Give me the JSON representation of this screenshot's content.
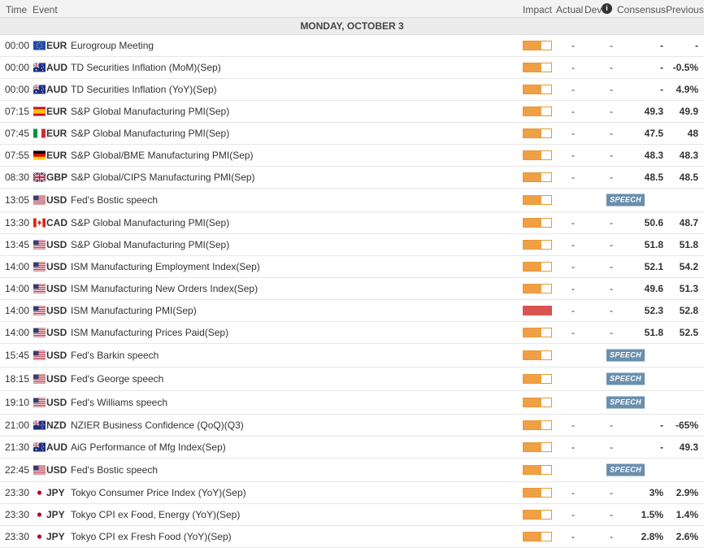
{
  "header": {
    "time": "Time",
    "event": "Event",
    "impact": "Impact",
    "actual": "Actual",
    "dev": "Dev",
    "info_icon": "i",
    "consensus": "Consensus",
    "previous": "Previous"
  },
  "day_label": "MONDAY, OCTOBER 3",
  "colors": {
    "impact_medium": "#f0a044",
    "impact_high": "#d9534f",
    "speech_tag": "#6a8fae"
  },
  "events": [
    {
      "time": "00:00",
      "flag": "eu",
      "currency": "EUR",
      "event": "Eurogroup Meeting",
      "impact": "medium",
      "impact_level": 0.66,
      "actual": "-",
      "dev": "-",
      "consensus": "-",
      "previous": "-"
    },
    {
      "time": "00:00",
      "flag": "au",
      "currency": "AUD",
      "event": "TD Securities Inflation (MoM)(Sep)",
      "impact": "medium",
      "impact_level": 0.66,
      "actual": "-",
      "dev": "-",
      "consensus": "-",
      "previous": "-0.5%"
    },
    {
      "time": "00:00",
      "flag": "au",
      "currency": "AUD",
      "event": "TD Securities Inflation (YoY)(Sep)",
      "impact": "medium",
      "impact_level": 0.66,
      "actual": "-",
      "dev": "-",
      "consensus": "-",
      "previous": "4.9%"
    },
    {
      "time": "07:15",
      "flag": "es",
      "currency": "EUR",
      "event": "S&P Global Manufacturing PMI(Sep)",
      "impact": "medium",
      "impact_level": 0.66,
      "actual": "-",
      "dev": "-",
      "consensus": "49.3",
      "previous": "49.9"
    },
    {
      "time": "07:45",
      "flag": "it",
      "currency": "EUR",
      "event": "S&P Global Manufacturing PMI(Sep)",
      "impact": "medium",
      "impact_level": 0.66,
      "actual": "-",
      "dev": "-",
      "consensus": "47.5",
      "previous": "48"
    },
    {
      "time": "07:55",
      "flag": "de",
      "currency": "EUR",
      "event": "S&P Global/BME Manufacturing PMI(Sep)",
      "impact": "medium",
      "impact_level": 0.66,
      "actual": "-",
      "dev": "-",
      "consensus": "48.3",
      "previous": "48.3"
    },
    {
      "time": "08:30",
      "flag": "gb",
      "currency": "GBP",
      "event": "S&P Global/CIPS Manufacturing PMI(Sep)",
      "impact": "medium",
      "impact_level": 0.66,
      "actual": "-",
      "dev": "-",
      "consensus": "48.5",
      "previous": "48.5"
    },
    {
      "time": "13:05",
      "flag": "us",
      "currency": "USD",
      "event": "Fed's Bostic speech",
      "impact": "medium",
      "impact_level": 0.66,
      "speech": "SPEECH"
    },
    {
      "time": "13:30",
      "flag": "ca",
      "currency": "CAD",
      "event": "S&P Global Manufacturing PMI(Sep)",
      "impact": "medium",
      "impact_level": 0.66,
      "actual": "-",
      "dev": "-",
      "consensus": "50.6",
      "previous": "48.7"
    },
    {
      "time": "13:45",
      "flag": "us",
      "currency": "USD",
      "event": "S&P Global Manufacturing PMI(Sep)",
      "impact": "medium",
      "impact_level": 0.66,
      "actual": "-",
      "dev": "-",
      "consensus": "51.8",
      "previous": "51.8"
    },
    {
      "time": "14:00",
      "flag": "us",
      "currency": "USD",
      "event": "ISM Manufacturing Employment Index(Sep)",
      "impact": "medium",
      "impact_level": 0.66,
      "actual": "-",
      "dev": "-",
      "consensus": "52.1",
      "previous": "54.2"
    },
    {
      "time": "14:00",
      "flag": "us",
      "currency": "USD",
      "event": "ISM Manufacturing New Orders Index(Sep)",
      "impact": "medium",
      "impact_level": 0.66,
      "actual": "-",
      "dev": "-",
      "consensus": "49.6",
      "previous": "51.3"
    },
    {
      "time": "14:00",
      "flag": "us",
      "currency": "USD",
      "event": "ISM Manufacturing PMI(Sep)",
      "impact": "high",
      "impact_level": 1.0,
      "actual": "-",
      "dev": "-",
      "consensus": "52.3",
      "previous": "52.8"
    },
    {
      "time": "14:00",
      "flag": "us",
      "currency": "USD",
      "event": "ISM Manufacturing Prices Paid(Sep)",
      "impact": "medium",
      "impact_level": 0.66,
      "actual": "-",
      "dev": "-",
      "consensus": "51.8",
      "previous": "52.5"
    },
    {
      "time": "15:45",
      "flag": "us",
      "currency": "USD",
      "event": "Fed's Barkin speech",
      "impact": "medium",
      "impact_level": 0.66,
      "speech": "SPEECH"
    },
    {
      "time": "18:15",
      "flag": "us",
      "currency": "USD",
      "event": "Fed's George speech",
      "impact": "medium",
      "impact_level": 0.66,
      "speech": "SPEECH"
    },
    {
      "time": "19:10",
      "flag": "us",
      "currency": "USD",
      "event": "Fed's Williams speech",
      "impact": "medium",
      "impact_level": 0.66,
      "speech": "SPEECH"
    },
    {
      "time": "21:00",
      "flag": "nz",
      "currency": "NZD",
      "event": "NZIER Business Confidence (QoQ)(Q3)",
      "impact": "medium",
      "impact_level": 0.66,
      "actual": "-",
      "dev": "-",
      "consensus": "-",
      "previous": "-65%"
    },
    {
      "time": "21:30",
      "flag": "au",
      "currency": "AUD",
      "event": "AiG Performance of Mfg Index(Sep)",
      "impact": "medium",
      "impact_level": 0.66,
      "actual": "-",
      "dev": "-",
      "consensus": "-",
      "previous": "49.3"
    },
    {
      "time": "22:45",
      "flag": "us",
      "currency": "USD",
      "event": "Fed's Bostic speech",
      "impact": "medium",
      "impact_level": 0.66,
      "speech": "SPEECH"
    },
    {
      "time": "23:30",
      "flag": "jp",
      "currency": "JPY",
      "event": "Tokyo Consumer Price Index (YoY)(Sep)",
      "impact": "medium",
      "impact_level": 0.66,
      "actual": "-",
      "dev": "-",
      "consensus": "3%",
      "previous": "2.9%"
    },
    {
      "time": "23:30",
      "flag": "jp",
      "currency": "JPY",
      "event": "Tokyo CPI ex Food, Energy (YoY)(Sep)",
      "impact": "medium",
      "impact_level": 0.66,
      "actual": "-",
      "dev": "-",
      "consensus": "1.5%",
      "previous": "1.4%"
    },
    {
      "time": "23:30",
      "flag": "jp",
      "currency": "JPY",
      "event": "Tokyo CPI ex Fresh Food (YoY)(Sep)",
      "impact": "medium",
      "impact_level": 0.66,
      "actual": "-",
      "dev": "-",
      "consensus": "2.8%",
      "previous": "2.6%"
    }
  ]
}
